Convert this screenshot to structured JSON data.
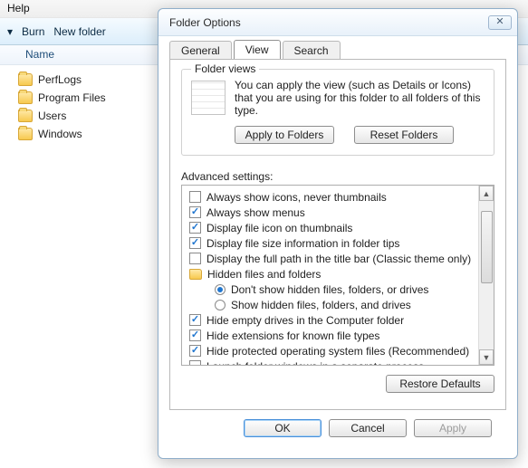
{
  "menubar": {
    "help": "Help"
  },
  "toolbar": {
    "organize_suffix": "▾",
    "burn": "Burn",
    "newfolder": "New folder"
  },
  "columns": {
    "name": "Name"
  },
  "files": {
    "items": [
      {
        "label": "PerfLogs"
      },
      {
        "label": "Program Files"
      },
      {
        "label": "Users"
      },
      {
        "label": "Windows"
      }
    ]
  },
  "dialog": {
    "title": "Folder Options",
    "close_icon": "✕",
    "tabs": {
      "general": "General",
      "view": "View",
      "search": "Search"
    },
    "folder_views": {
      "label": "Folder views",
      "text": "You can apply the view (such as Details or Icons) that you are using for this folder to all folders of this type.",
      "apply": "Apply to Folders",
      "reset": "Reset Folders"
    },
    "advanced": {
      "label": "Advanced settings:",
      "items": [
        {
          "type": "check",
          "checked": false,
          "label": "Always show icons, never thumbnails"
        },
        {
          "type": "check",
          "checked": true,
          "label": "Always show menus"
        },
        {
          "type": "check",
          "checked": true,
          "label": "Display file icon on thumbnails"
        },
        {
          "type": "check",
          "checked": true,
          "label": "Display file size information in folder tips"
        },
        {
          "type": "check",
          "checked": false,
          "label": "Display the full path in the title bar (Classic theme only)"
        },
        {
          "type": "folder",
          "label": "Hidden files and folders"
        },
        {
          "type": "radio",
          "checked": true,
          "indent": true,
          "label": "Don't show hidden files, folders, or drives"
        },
        {
          "type": "radio",
          "checked": false,
          "indent": true,
          "label": "Show hidden files, folders, and drives"
        },
        {
          "type": "check",
          "checked": true,
          "label": "Hide empty drives in the Computer folder"
        },
        {
          "type": "check",
          "checked": true,
          "label": "Hide extensions for known file types"
        },
        {
          "type": "check",
          "checked": true,
          "label": "Hide protected operating system files (Recommended)"
        },
        {
          "type": "check",
          "checked": false,
          "label": "Launch folder windows in a separate process"
        }
      ]
    },
    "restore_defaults": "Restore Defaults",
    "ok": "OK",
    "cancel": "Cancel",
    "apply": "Apply"
  }
}
